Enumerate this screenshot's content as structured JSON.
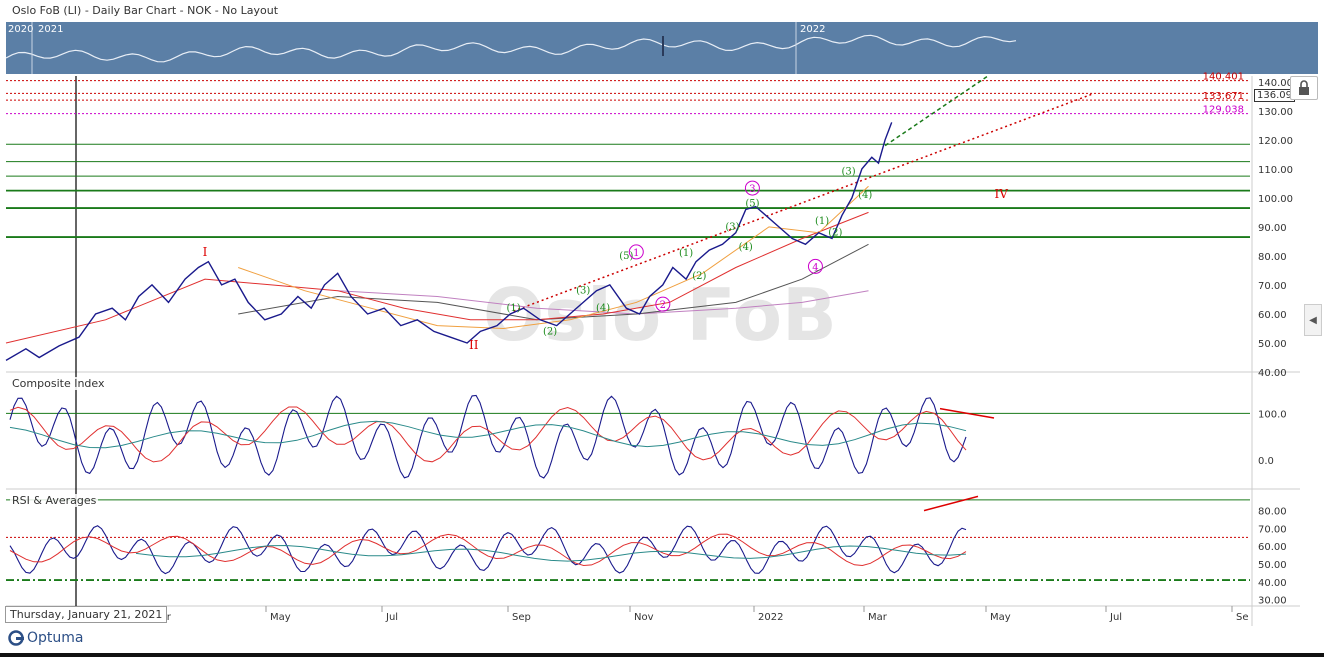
{
  "header": {
    "title": "Oslo FoB (LI) - Daily Bar Chart - NOK - No Layout"
  },
  "overview": {
    "labels": [
      "2020",
      "2021",
      "2022"
    ]
  },
  "watermark": "Oslo FoB",
  "cursor_date": "Thursday, January 21, 2021",
  "logo_text": "Optuma",
  "price_tag": "136.09",
  "colors": {
    "price": "#1a1a8c",
    "ma_orange": "#f0a040",
    "ma_red": "#e03030",
    "ma_gray": "#555555",
    "ma_purple": "#c080c0",
    "green_lines": "#1a7a1a",
    "red_dotted": "#cc0000",
    "magenta_dotted": "#cc00cc",
    "teal": "#2a8a8a",
    "overview_bg": "#5b7fa6"
  },
  "chart_data": [
    {
      "type": "line",
      "title": "Oslo FoB (LI) - Daily Bar Chart - NOK - No Layout",
      "x_labels": [
        "Mar",
        "May",
        "Jul",
        "Sep",
        "Nov",
        "2022",
        "Mar",
        "May",
        "Jul",
        "Se"
      ],
      "y_ticks": [
        "40.00",
        "50.00",
        "60.00",
        "70.00",
        "80.00",
        "90.00",
        "100.00",
        "110.00",
        "120.00",
        "130.00",
        "140.00"
      ],
      "ylim": [
        40,
        142
      ],
      "price_points": [
        [
          0,
          44
        ],
        [
          0.6,
          48
        ],
        [
          1,
          45
        ],
        [
          1.6,
          49
        ],
        [
          2.2,
          52
        ],
        [
          2.7,
          60
        ],
        [
          3.2,
          62
        ],
        [
          3.6,
          58
        ],
        [
          4,
          66
        ],
        [
          4.4,
          70
        ],
        [
          4.9,
          64
        ],
        [
          5.4,
          72
        ],
        [
          5.8,
          76
        ],
        [
          6.1,
          78
        ],
        [
          6.5,
          70
        ],
        [
          6.9,
          72
        ],
        [
          7.3,
          64
        ],
        [
          7.8,
          58
        ],
        [
          8.3,
          60
        ],
        [
          8.8,
          66
        ],
        [
          9.2,
          62
        ],
        [
          9.6,
          70
        ],
        [
          10,
          74
        ],
        [
          10.4,
          66
        ],
        [
          10.9,
          60
        ],
        [
          11.4,
          62
        ],
        [
          11.9,
          56
        ],
        [
          12.4,
          58
        ],
        [
          12.9,
          54
        ],
        [
          13.4,
          52
        ],
        [
          13.9,
          50
        ],
        [
          14.3,
          54
        ],
        [
          14.8,
          56
        ],
        [
          15.2,
          60
        ],
        [
          15.6,
          62
        ],
        [
          16.1,
          58
        ],
        [
          16.6,
          56
        ],
        [
          17,
          60
        ],
        [
          17.4,
          64
        ],
        [
          17.8,
          68
        ],
        [
          18.2,
          70
        ],
        [
          18.7,
          62
        ],
        [
          19.1,
          60
        ],
        [
          19.4,
          66
        ],
        [
          19.8,
          70
        ],
        [
          20.1,
          76
        ],
        [
          20.5,
          72
        ],
        [
          20.8,
          78
        ],
        [
          21.2,
          82
        ],
        [
          21.6,
          84
        ],
        [
          22,
          88
        ],
        [
          22.3,
          96
        ],
        [
          22.6,
          97
        ],
        [
          22.9,
          94
        ],
        [
          23.3,
          90
        ],
        [
          23.7,
          86
        ],
        [
          24.1,
          84
        ],
        [
          24.5,
          88
        ],
        [
          24.9,
          86
        ],
        [
          25.2,
          94
        ],
        [
          25.5,
          100
        ],
        [
          25.8,
          110
        ],
        [
          26.1,
          114
        ],
        [
          26.3,
          112
        ],
        [
          26.5,
          120
        ],
        [
          26.7,
          126
        ]
      ],
      "ma_orange": [
        [
          7,
          76
        ],
        [
          9,
          68
        ],
        [
          11,
          62
        ],
        [
          13,
          56
        ],
        [
          15,
          55
        ],
        [
          17,
          58
        ],
        [
          19,
          64
        ],
        [
          21,
          74
        ],
        [
          23,
          90
        ],
        [
          24.5,
          88
        ],
        [
          26,
          104
        ]
      ],
      "ma_red": [
        [
          0,
          50
        ],
        [
          3,
          58
        ],
        [
          6,
          72
        ],
        [
          8,
          70
        ],
        [
          10,
          68
        ],
        [
          12,
          62
        ],
        [
          14,
          58
        ],
        [
          16,
          58
        ],
        [
          18,
          60
        ],
        [
          20,
          64
        ],
        [
          22,
          76
        ],
        [
          24,
          86
        ],
        [
          26,
          95
        ]
      ],
      "ma_gray": [
        [
          7,
          60
        ],
        [
          10,
          66
        ],
        [
          13,
          64
        ],
        [
          16,
          58
        ],
        [
          19,
          60
        ],
        [
          22,
          64
        ],
        [
          24,
          72
        ],
        [
          26,
          84
        ]
      ],
      "ma_purple": [
        [
          10,
          68
        ],
        [
          13,
          66
        ],
        [
          16,
          62
        ],
        [
          19,
          60
        ],
        [
          22,
          62
        ],
        [
          24,
          64
        ],
        [
          26,
          68
        ]
      ],
      "horizontal_levels": [
        {
          "value": 86.5,
          "style": "solid",
          "color": "green"
        },
        {
          "value": 96.5,
          "style": "solid",
          "color": "green"
        },
        {
          "value": 102.5,
          "style": "solid",
          "color": "green"
        },
        {
          "value": 107.5,
          "style": "solid",
          "color": "green"
        },
        {
          "value": 112.5,
          "style": "solid",
          "color": "green"
        },
        {
          "value": 118.5,
          "style": "solid",
          "color": "green"
        },
        {
          "value": 129.038,
          "style": "dotted",
          "color": "magenta",
          "label": "129.038"
        },
        {
          "value": 133.671,
          "style": "dotted",
          "color": "red",
          "label": "133.671"
        },
        {
          "value": 136.0,
          "style": "dotted",
          "color": "red"
        },
        {
          "value": 140.401,
          "style": "dotted",
          "color": "red",
          "label": "140.401"
        }
      ],
      "wave_labels": [
        {
          "text": "I",
          "x": 6.0,
          "y": 80,
          "color": "red"
        },
        {
          "text": "II",
          "x": 14.1,
          "y": 48,
          "color": "red"
        },
        {
          "text": "IV",
          "x": 30.0,
          "y": 100,
          "color": "red"
        },
        {
          "text": "(1)",
          "x": 15.3,
          "y": 61,
          "color": "green"
        },
        {
          "text": "(2)",
          "x": 16.4,
          "y": 53,
          "color": "green"
        },
        {
          "text": "(3)",
          "x": 17.4,
          "y": 67,
          "color": "green"
        },
        {
          "text": "(4)",
          "x": 18.0,
          "y": 61,
          "color": "green"
        },
        {
          "text": "(5)",
          "x": 18.7,
          "y": 79,
          "color": "green"
        },
        {
          "text": "(1)",
          "x": 20.5,
          "y": 80,
          "color": "green"
        },
        {
          "text": "(2)",
          "x": 20.9,
          "y": 72,
          "color": "green"
        },
        {
          "text": "(3)",
          "x": 21.9,
          "y": 89,
          "color": "green"
        },
        {
          "text": "(4)",
          "x": 22.3,
          "y": 82,
          "color": "green"
        },
        {
          "text": "(5)",
          "x": 22.5,
          "y": 97,
          "color": "green"
        },
        {
          "text": "(1)",
          "x": 24.6,
          "y": 91,
          "color": "green"
        },
        {
          "text": "(2)",
          "x": 25.0,
          "y": 87,
          "color": "green"
        },
        {
          "text": "(3)",
          "x": 25.4,
          "y": 108,
          "color": "green"
        },
        {
          "text": "(4)",
          "x": 25.9,
          "y": 100,
          "color": "green"
        },
        {
          "text": "1",
          "x": 19.0,
          "y": 80,
          "color": "magenta"
        },
        {
          "text": "2",
          "x": 19.8,
          "y": 62,
          "color": "magenta"
        },
        {
          "text": "3",
          "x": 22.5,
          "y": 102,
          "color": "magenta"
        },
        {
          "text": "4",
          "x": 24.4,
          "y": 75,
          "color": "magenta"
        }
      ]
    },
    {
      "type": "line",
      "title": "Composite Index",
      "y_ticks": [
        "0.0",
        "100.0"
      ],
      "ylim": [
        -60,
        180
      ],
      "reference_line": 100
    },
    {
      "type": "line",
      "title": "RSI & Averages",
      "y_ticks": [
        "30.00",
        "40.00",
        "50.00",
        "60.00",
        "70.00",
        "80.00"
      ],
      "ylim": [
        27,
        91
      ],
      "reference_levels": [
        {
          "value": 86,
          "style": "solid"
        },
        {
          "value": 65,
          "style": "dotted"
        },
        {
          "value": 41,
          "style": "dash-dot"
        }
      ]
    }
  ]
}
